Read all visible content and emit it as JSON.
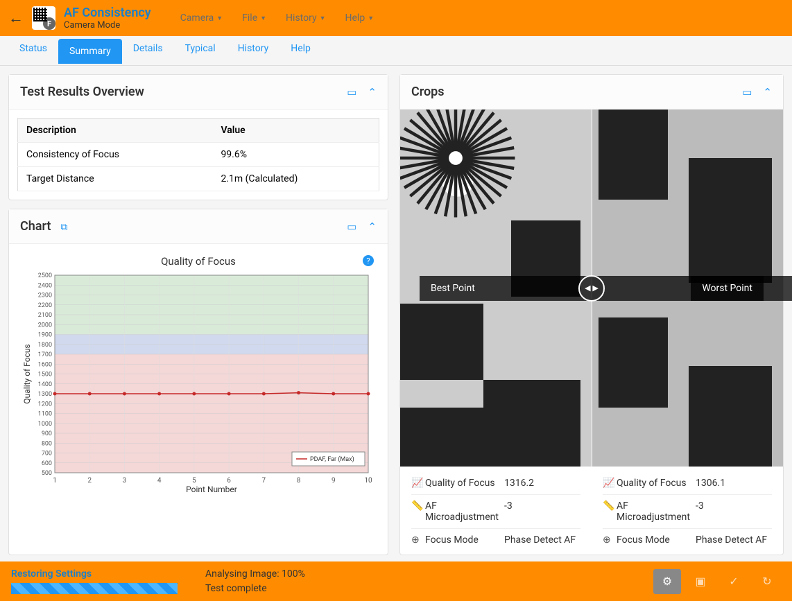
{
  "header": {
    "title": "AF Consistency",
    "subtitle": "Camera Mode",
    "menu": [
      "Camera",
      "File",
      "History",
      "Help"
    ]
  },
  "tabs": [
    "Status",
    "Summary",
    "Details",
    "Typical",
    "History",
    "Help"
  ],
  "active_tab": "Summary",
  "results_panel": {
    "title": "Test Results Overview",
    "columns": [
      "Description",
      "Value"
    ],
    "rows": [
      {
        "desc": "Consistency of Focus",
        "val": "99.6%"
      },
      {
        "desc": "Target Distance",
        "val": "2.1m (Calculated)"
      }
    ]
  },
  "chart_panel": {
    "title": "Chart"
  },
  "chart_data": {
    "type": "line",
    "title": "Quality of Focus",
    "xlabel": "Point Number",
    "ylabel": "Quality of Focus",
    "x": [
      1,
      2,
      3,
      4,
      5,
      6,
      7,
      8,
      9,
      10
    ],
    "series": [
      {
        "name": "PDAF, Far (Max)",
        "values": [
          1300,
          1300,
          1300,
          1300,
          1300,
          1300,
          1300,
          1310,
          1300,
          1300
        ]
      }
    ],
    "y_ticks": [
      500,
      600,
      700,
      800,
      900,
      1000,
      1100,
      1200,
      1300,
      1400,
      1500,
      1600,
      1700,
      1800,
      1900,
      2000,
      2100,
      2200,
      2300,
      2400,
      2500
    ],
    "ylim": [
      500,
      2500
    ],
    "zones": [
      {
        "from": 1900,
        "to": 2500,
        "color": "#d9ead9"
      },
      {
        "from": 1700,
        "to": 1900,
        "color": "#d0d9ed"
      },
      {
        "from": 500,
        "to": 1700,
        "color": "#f4d7d7"
      }
    ]
  },
  "crops_panel": {
    "title": "Crops",
    "best_label": "Best Point",
    "worst_label": "Worst Point",
    "stats_labels": {
      "qof": "Quality of Focus",
      "afma": "AF Microadjustment",
      "mode": "Focus Mode"
    },
    "best": {
      "qof": "1316.2",
      "afma": "-3",
      "mode": "Phase Detect AF"
    },
    "worst": {
      "qof": "1306.1",
      "afma": "-3",
      "mode": "Phase Detect AF"
    }
  },
  "footer": {
    "title": "Restoring Settings",
    "progress_pct": 100,
    "line1": "Analysing Image: 100%",
    "line2": "Test complete"
  }
}
